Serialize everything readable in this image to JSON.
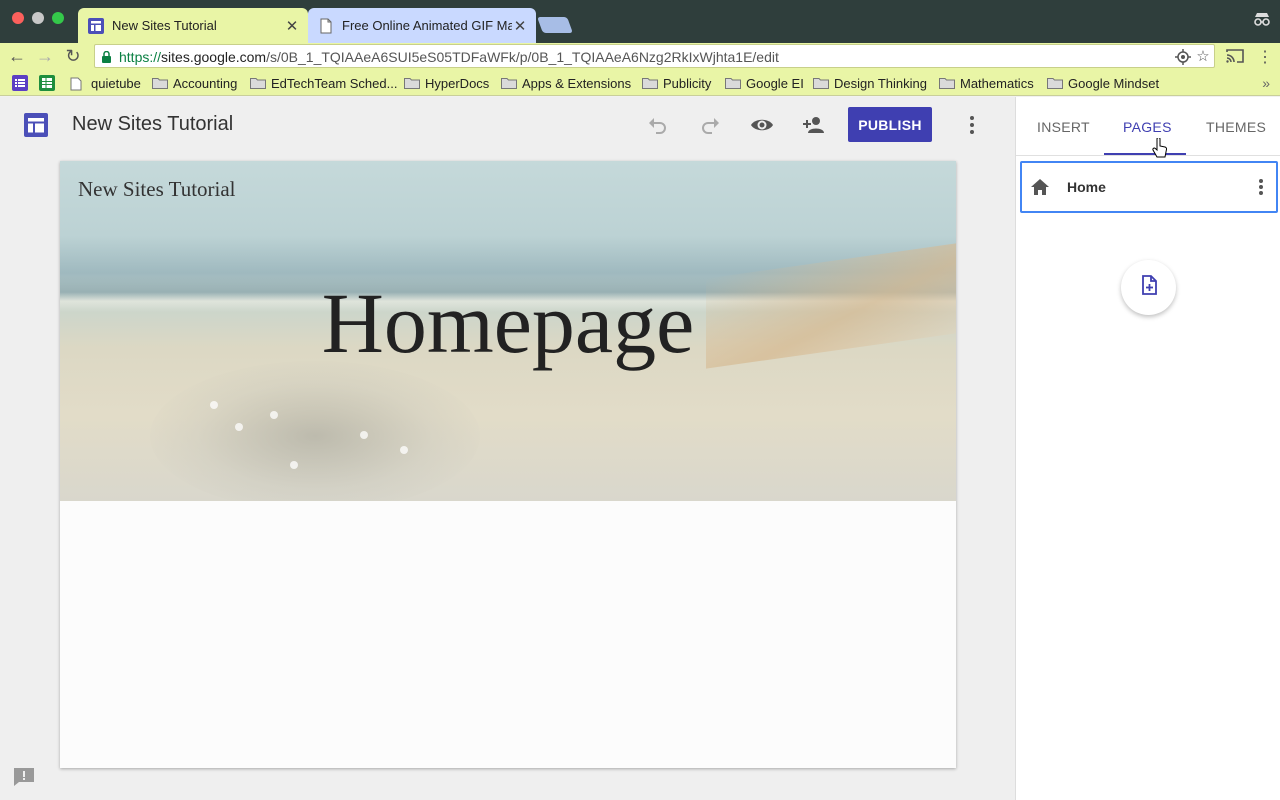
{
  "browser": {
    "tabs": [
      {
        "title": "New Sites Tutorial",
        "favicon": "google-sites-icon",
        "active": true
      },
      {
        "title": "Free Online Animated GIF Mak",
        "favicon": "document-icon",
        "active": false
      }
    ],
    "address_bar": {
      "scheme": "https://",
      "host": "sites.google.com",
      "path": "/s/0B_1_TQIAAeA6SUI5eS05TDFaWFk/p/0B_1_TQIAAeA6Nzg2RkIxWjhta1E/edit"
    },
    "bookmarks": [
      {
        "label": "quietube",
        "icon": "page-icon"
      },
      {
        "label": "Accounting",
        "icon": "folder-icon"
      },
      {
        "label": "EdTechTeam Sched...",
        "icon": "folder-icon"
      },
      {
        "label": "HyperDocs",
        "icon": "folder-icon"
      },
      {
        "label": "Apps & Extensions",
        "icon": "folder-icon"
      },
      {
        "label": "Publicity",
        "icon": "folder-icon"
      },
      {
        "label": "Google EI",
        "icon": "folder-icon"
      },
      {
        "label": "Design Thinking",
        "icon": "folder-icon"
      },
      {
        "label": "Mathematics",
        "icon": "folder-icon"
      },
      {
        "label": "Google Mindset",
        "icon": "folder-icon"
      }
    ],
    "bookmarks_more": "»"
  },
  "editor": {
    "site_title": "New Sites Tutorial",
    "publish_label": "PUBLISH",
    "header": {
      "site_name": "New Sites Tutorial",
      "page_title": "Homepage"
    }
  },
  "panel": {
    "tabs": [
      "INSERT",
      "PAGES",
      "THEMES"
    ],
    "active_tab": "PAGES",
    "pages": [
      {
        "name": "Home",
        "icon": "home-icon"
      }
    ]
  },
  "colors": {
    "chrome_dark": "#2f3e3c",
    "toolbar": "#e9f5a6",
    "accent": "#3f3fb1",
    "selection_border": "#4285f4"
  }
}
